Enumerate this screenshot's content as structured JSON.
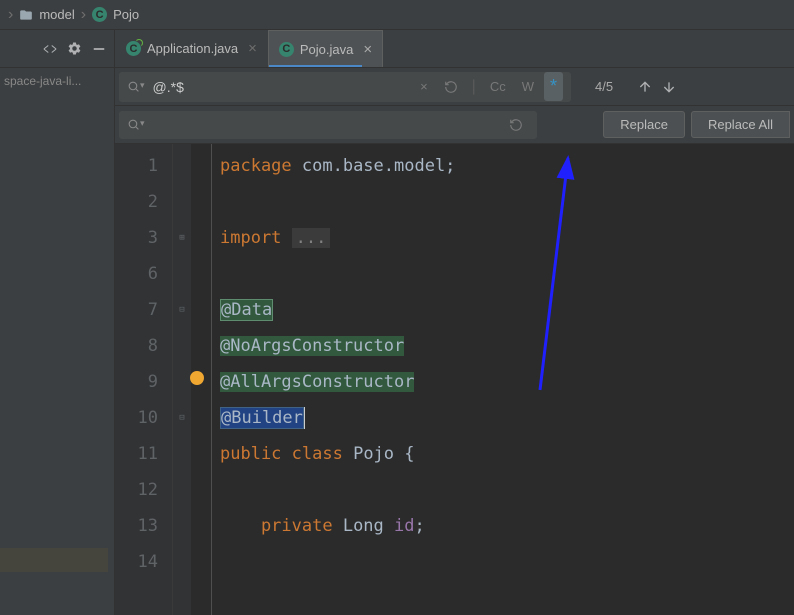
{
  "breadcrumb": {
    "item1": "model",
    "item2": "Pojo",
    "item2_icon_letter": "C"
  },
  "tabs": [
    {
      "label": "Application.java",
      "icon_letter": "C",
      "active": false
    },
    {
      "label": "Pojo.java",
      "icon_letter": "C",
      "active": true
    }
  ],
  "sidebar": {
    "line": "space-java-li..."
  },
  "search": {
    "query": "@.*$",
    "match_count": "4/5",
    "case_label": "Cc",
    "word_label": "W",
    "regex_label": "*"
  },
  "replace": {
    "btn_replace": "Replace",
    "btn_replace_all": "Replace All"
  },
  "editor": {
    "line_numbers": [
      "1",
      "2",
      "3",
      "6",
      "7",
      "8",
      "9",
      "10",
      "11",
      "12",
      "13",
      "14"
    ],
    "lines": {
      "l1_kw": "package",
      "l1_ident": " com.base.model;",
      "l3_kw": "import ",
      "l3_fold": "...",
      "l7": "@Data",
      "l8": "@NoArgsConstructor",
      "l9": "@AllArgsConstructor",
      "l10": "@Builder",
      "l11_kw1": "public ",
      "l11_kw2": "class ",
      "l11_name": "Pojo {",
      "l13_kw": "    private ",
      "l13_type": "Long ",
      "l13_field": "id",
      "l13_semi": ";"
    }
  }
}
